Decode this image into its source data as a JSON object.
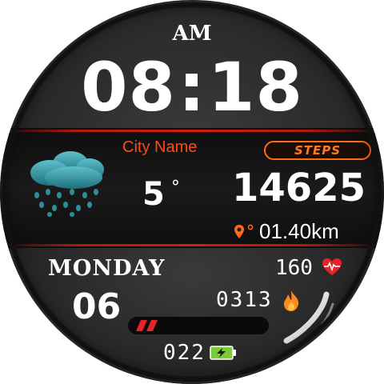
{
  "clock": {
    "ampm": "AM",
    "hours": "08",
    "separator": ":",
    "minutes": "18"
  },
  "weather": {
    "city": "City Name",
    "temperature": "5",
    "degree_symbol": "°",
    "icon": "rain-cloud-icon"
  },
  "steps": {
    "badge_label": "STEPS",
    "count": "14625",
    "distance": "01.40km",
    "distance_icon": "location-pin-icon"
  },
  "date": {
    "weekday": "MONDAY",
    "day": "06"
  },
  "health": {
    "heart_rate": "160",
    "heart_icon": "heart-pulse-icon",
    "calories": "0313",
    "calories_icon": "flame-icon"
  },
  "battery": {
    "level": "022",
    "icon": "battery-charging-icon",
    "progress_fraction": 0.22
  },
  "colors": {
    "accent_red": "#d01e10",
    "accent_orange": "#ff6a18",
    "weather_cyan": "#3fa6b2",
    "battery_green": "#7acb3a"
  }
}
